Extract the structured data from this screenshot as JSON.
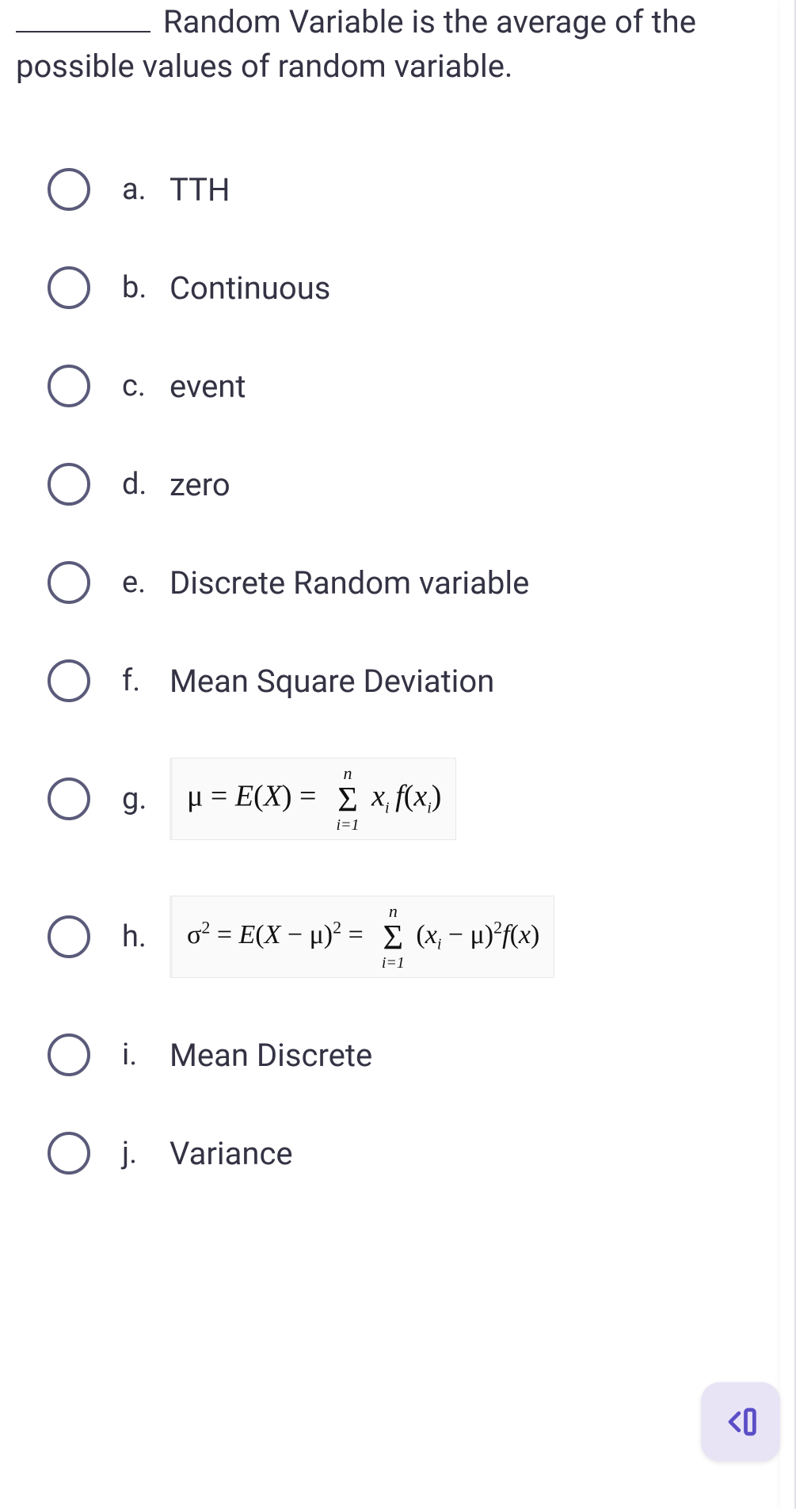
{
  "question": {
    "prefix_blank": true,
    "text": "Random Variable is the average of the possible values of random variable."
  },
  "options": [
    {
      "letter": "a.",
      "label": "TTH",
      "type": "text"
    },
    {
      "letter": "b.",
      "label": "Continuous",
      "type": "text"
    },
    {
      "letter": "c.",
      "label": "event",
      "type": "text"
    },
    {
      "letter": "d.",
      "label": "zero",
      "type": "text"
    },
    {
      "letter": "e.",
      "label": "Discrete Random variable",
      "type": "text"
    },
    {
      "letter": "f.",
      "label": "Mean Square Deviation",
      "type": "text"
    },
    {
      "letter": "g.",
      "label": "μ = E(X) = Σ_{i=1}^{n} x_i f(x_i)",
      "type": "formula"
    },
    {
      "letter": "h.",
      "label": "σ² = E(X − μ)² = Σ_{i=1}^{n} (x_i − μ)² f(x)",
      "type": "formula"
    },
    {
      "letter": "i.",
      "label": "Mean Discrete",
      "type": "text"
    },
    {
      "letter": "j.",
      "label": "Variance",
      "type": "text"
    }
  ],
  "fab": {
    "icon": "collapse-right-icon"
  }
}
